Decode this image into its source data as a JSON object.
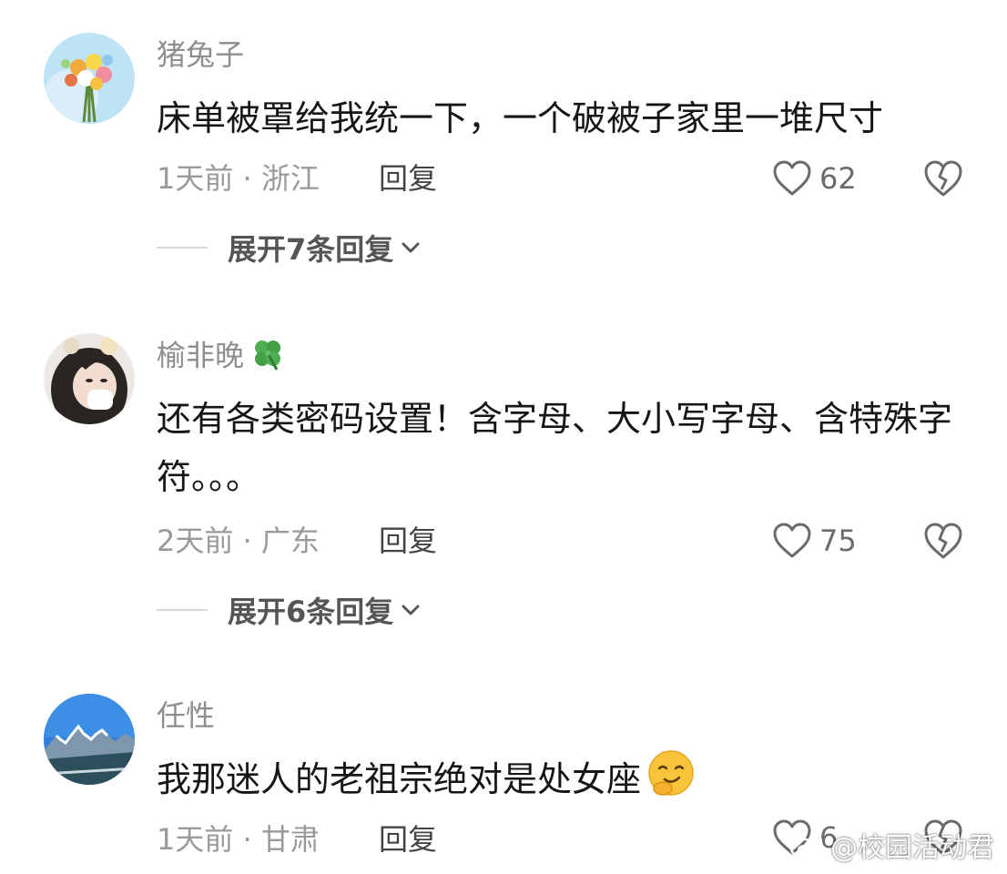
{
  "comments": [
    {
      "username": "猪兔子",
      "text": "床单被罩给我统一下，一个破被子家里一堆尺寸",
      "time_location": "1天前 · 浙江",
      "reply_label": "回复",
      "likes": "62",
      "expand_label": "展开7条回复",
      "avatar_icon": "flower-bouquet-avatar"
    },
    {
      "username": "榆非晚",
      "badge_icon": "four-leaf-clover-icon",
      "text": "还有各类密码设置！含字母、大小写字母、含特殊字符。。。",
      "time_location": "2天前 · 广东",
      "reply_label": "回复",
      "likes": "75",
      "expand_label": "展开6条回复",
      "avatar_icon": "girl-portrait-avatar"
    },
    {
      "username": "任性",
      "text": "我那迷人的老祖宗绝对是处女座",
      "emoji_icon": "smirking-face-emoji",
      "time_location": "1天前 · 甘肃",
      "reply_label": "回复",
      "likes": "6",
      "avatar_icon": "mountain-landscape-avatar"
    }
  ],
  "watermark": "@校园活动君",
  "colors": {
    "meta_gray": "#9a9a9a",
    "username_gray": "#8e8e8e",
    "text_dark": "#161616",
    "divider": "#d8d8d8"
  }
}
